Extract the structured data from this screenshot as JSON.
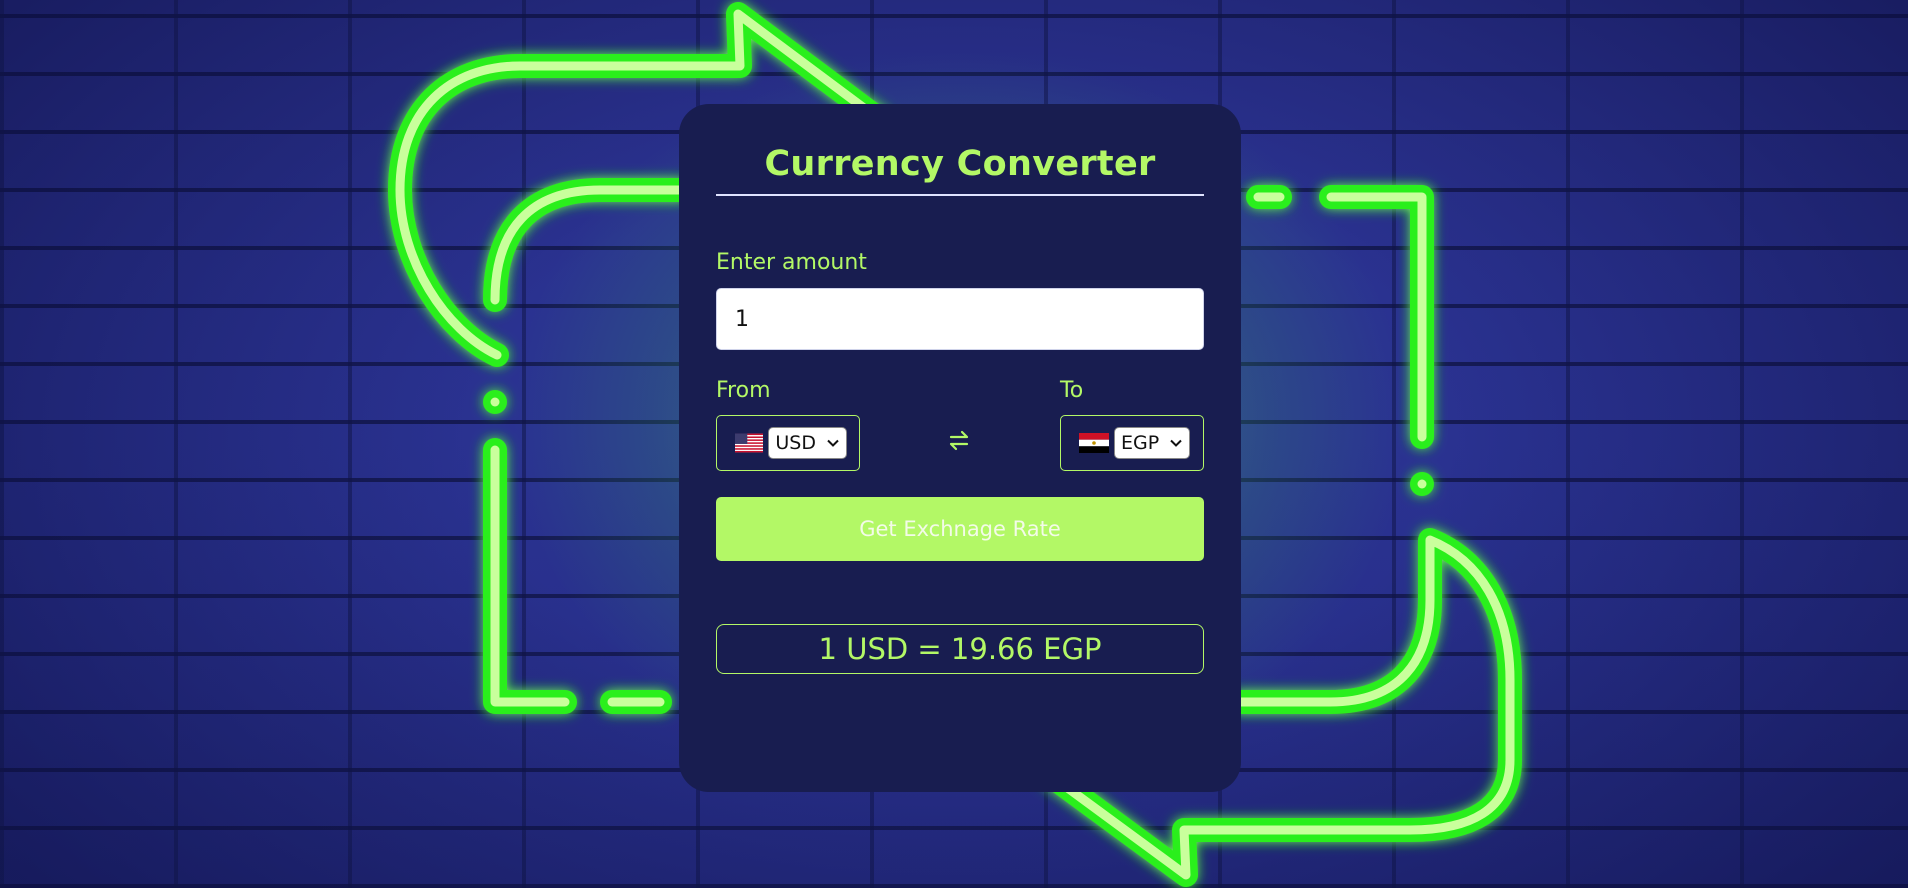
{
  "title": "Currency Converter",
  "amount": {
    "label": "Enter amount",
    "value": "1"
  },
  "from": {
    "label": "From",
    "currency": "USD",
    "flag_icon": "us-flag-icon"
  },
  "to": {
    "label": "To",
    "currency": "EGP",
    "flag_icon": "egypt-flag-icon"
  },
  "swap_icon": "swap-arrows-icon",
  "button": {
    "label": "Get Exchnage Rate"
  },
  "result": {
    "text": "1 USD = 19.66 EGP"
  },
  "colors": {
    "accent": "#b3f866",
    "card_background": "#181d50",
    "wall": "#2a3291",
    "neon": "#39ff14"
  }
}
